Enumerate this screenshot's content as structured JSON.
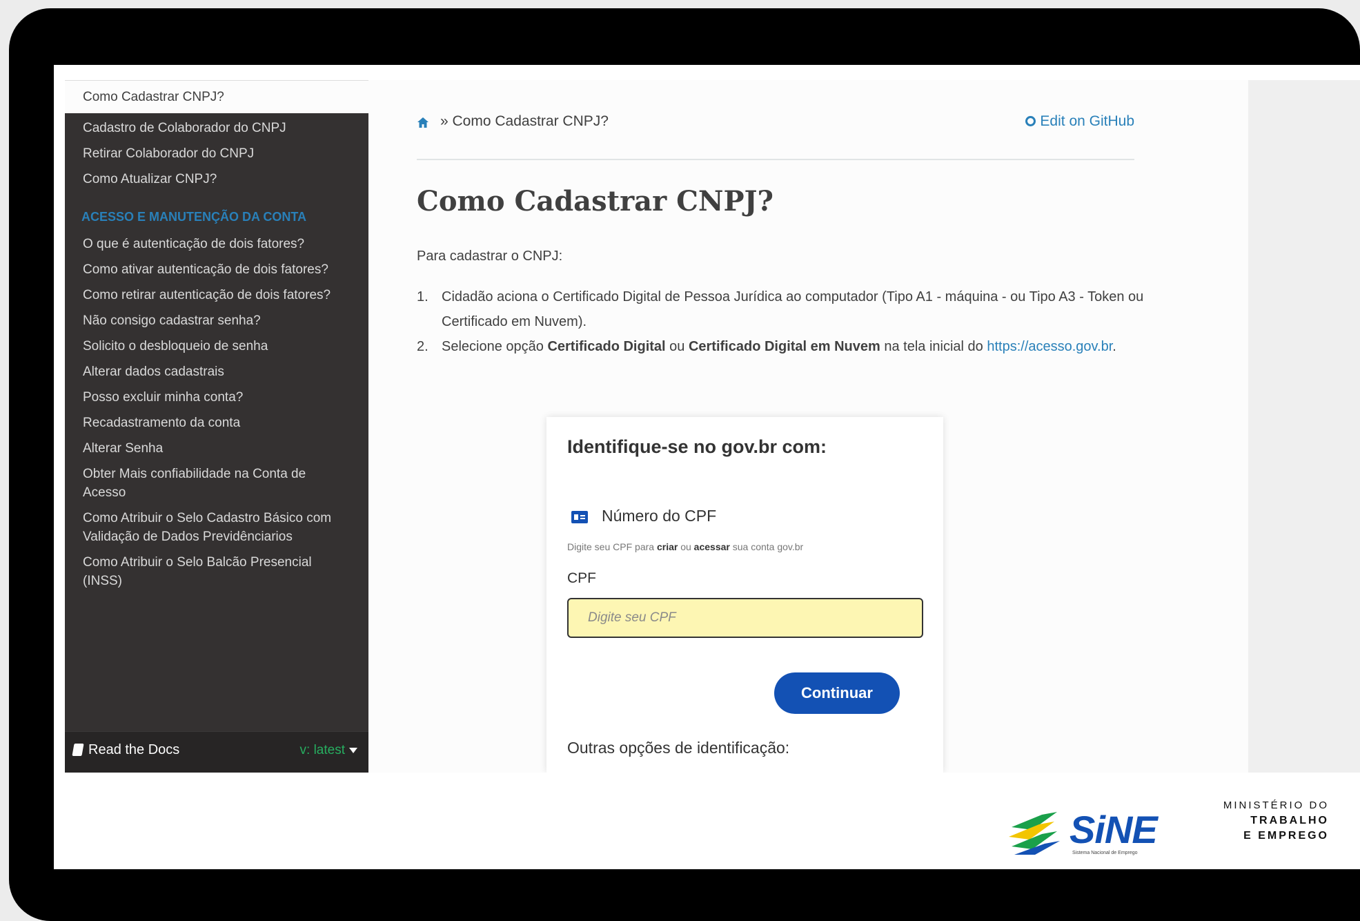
{
  "sidebar": {
    "current": "Como Cadastrar CNPJ?",
    "items_before_caption": [
      "Cadastro de Colaborador do CNPJ",
      "Retirar Colaborador do CNPJ",
      "Como Atualizar CNPJ?"
    ],
    "caption": "ACESSO E MANUTENÇÃO DA CONTA",
    "items_after_caption": [
      "O que é autenticação de dois fatores?",
      "Como ativar autenticação de dois fatores?",
      "Como retirar autenticação de dois fatores?",
      "Não consigo cadastrar senha?",
      "Solicito o desbloqueio de senha",
      "Alterar dados cadastrais",
      "Posso excluir minha conta?",
      "Recadastramento da conta",
      "Alterar Senha",
      "Obter Mais confiabilidade na Conta de Acesso",
      "Como Atribuir o Selo Cadastro Básico com Validação de Dados Previdênciarios",
      "Como Atribuir o Selo Balcão Presencial (INSS)"
    ]
  },
  "rtd": {
    "label": "Read the Docs",
    "version": "v: latest"
  },
  "breadcrumb": {
    "separator_text": "» Como Cadastrar CNPJ?",
    "edit_link": "Edit on GitHub"
  },
  "page": {
    "title": "Como Cadastrar CNPJ?",
    "intro": "Para cadastrar o CNPJ:",
    "step1": {
      "num": "1.",
      "text": "Cidadão aciona o Certificado Digital de Pessoa Jurídica ao computador (Tipo A1 - máquina - ou Tipo A3 - Token ou Certificado em Nuvem)."
    },
    "step2": {
      "num": "2.",
      "t1": "Selecione opção ",
      "b1": "Certificado Digital",
      "t2": " ou ",
      "b2": "Certificado Digital em Nuvem",
      "t3": " na tela inicial do ",
      "link": "https://acesso.gov.br",
      "t4": "."
    }
  },
  "govbr": {
    "title": "Identifique-se no gov.br com:",
    "option": "Número do CPF",
    "hint": {
      "t1": "Digite seu CPF para ",
      "b1": "criar",
      "t2": " ou ",
      "b2": "acessar",
      "t3": " sua conta gov.br"
    },
    "cpf_label": "CPF",
    "cpf_placeholder": "Digite seu CPF",
    "continue": "Continuar",
    "other": "Outras opções de identificação:"
  },
  "footer": {
    "sine": "SiNE",
    "sine_sub": "Sistema Nacional de Emprego",
    "ministry": [
      "MINISTÉRIO DO",
      "TRABALHO",
      "E EMPREGO"
    ]
  },
  "colors": {
    "sidebar_bg": "#343131",
    "link": "#2980b9",
    "govbr_blue": "#1351b4",
    "rtd_version": "#27ae60"
  },
  "icons": [
    "home-icon",
    "github-icon",
    "book-icon",
    "caret-down-icon",
    "cpf-card-icon"
  ]
}
